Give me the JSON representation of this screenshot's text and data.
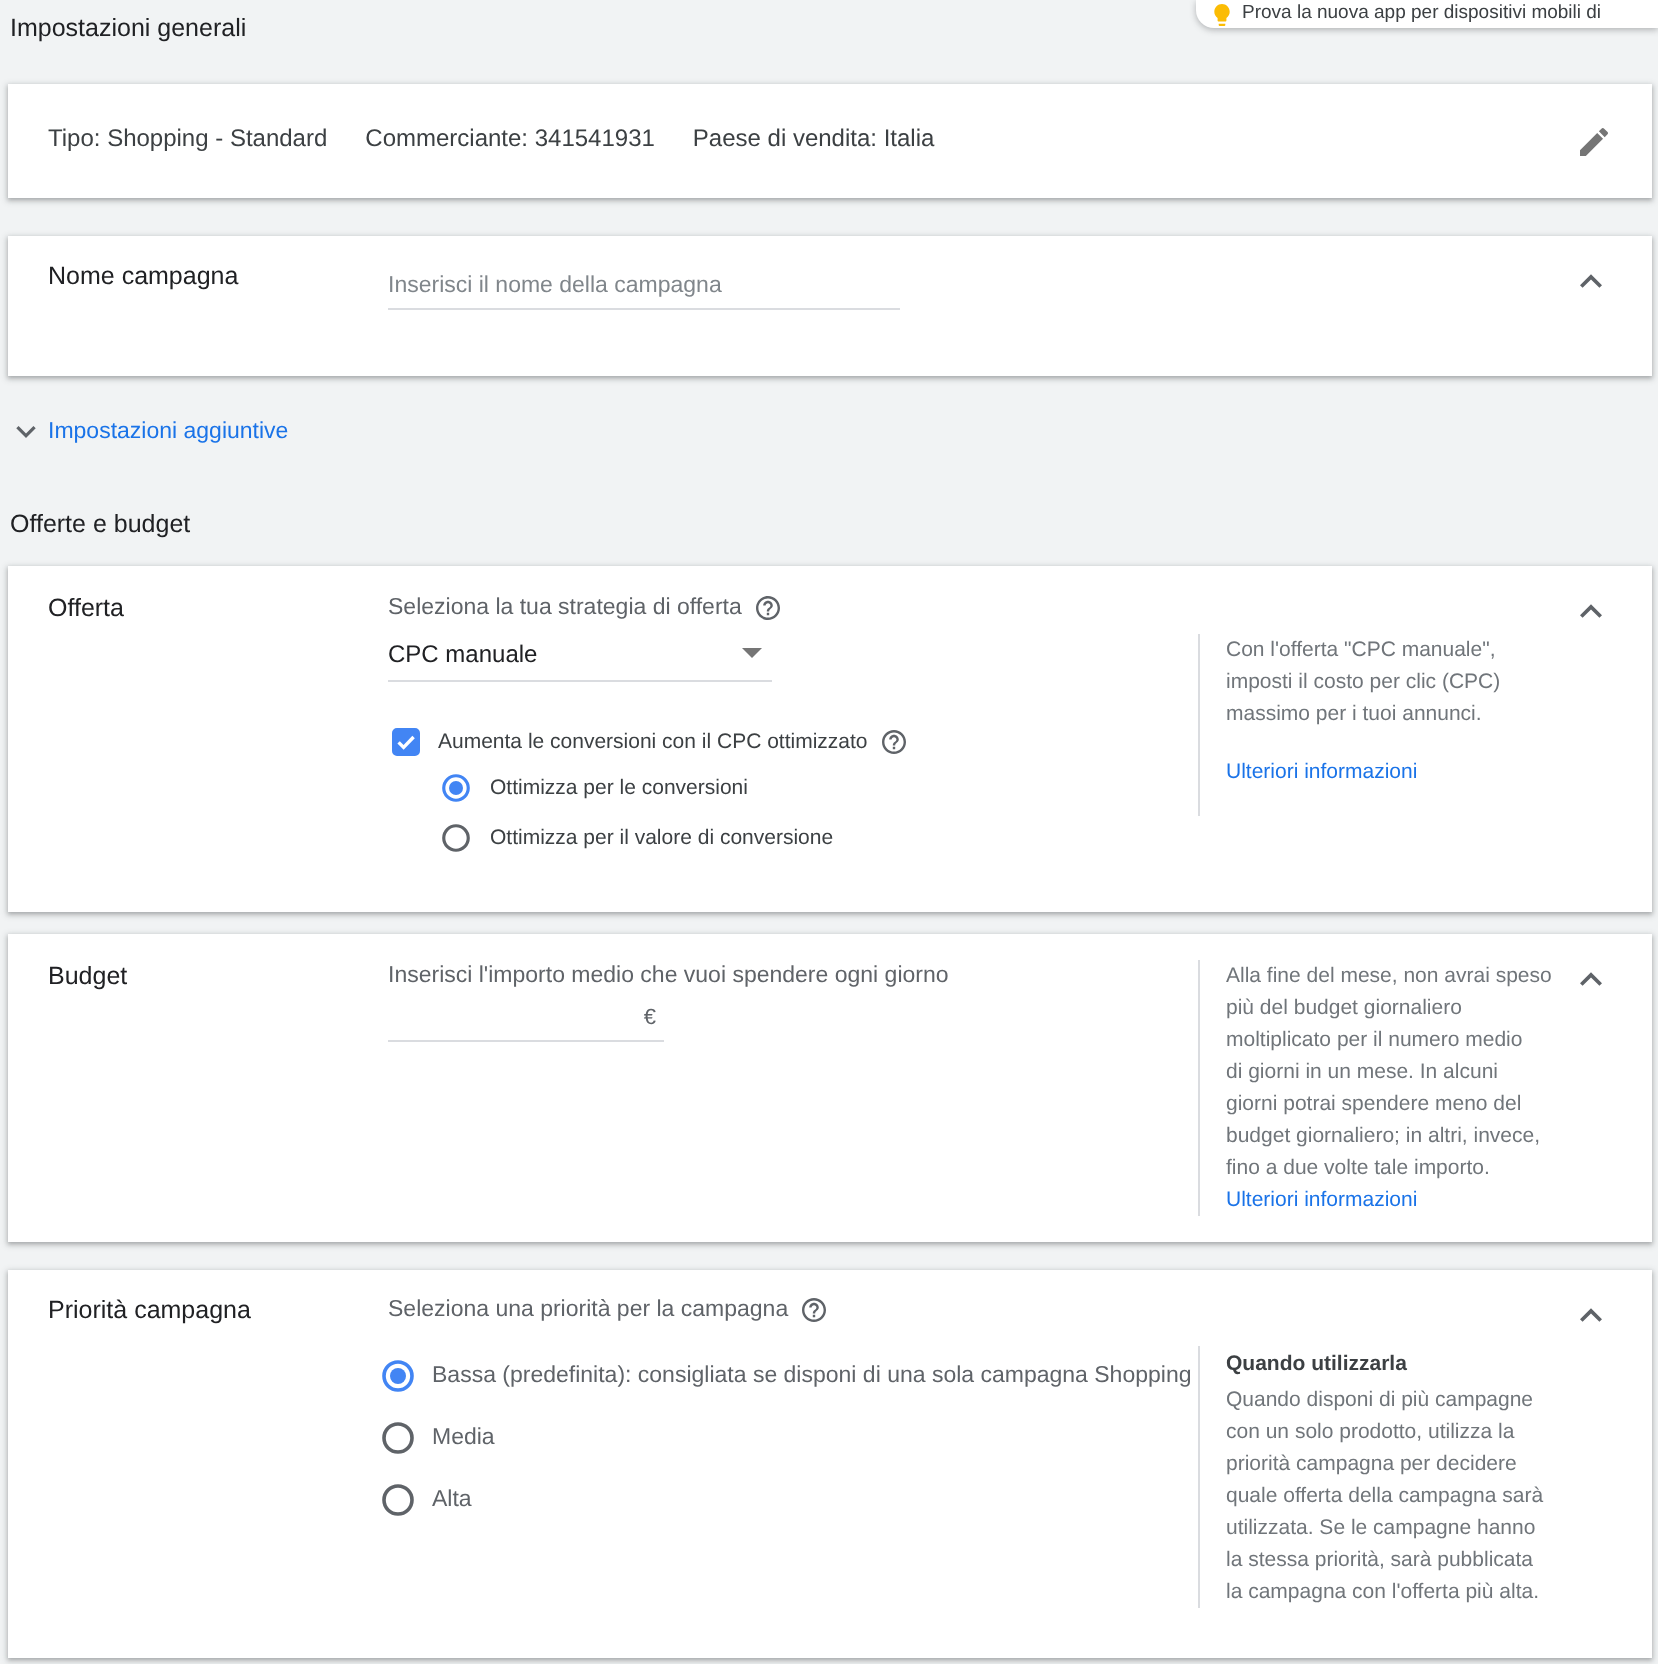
{
  "toast": {
    "text": "Prova la nuova app per dispositivi mobili di"
  },
  "general_settings": {
    "title": "Impostazioni generali",
    "summary": [
      "Tipo: Shopping - Standard",
      "Commerciante: 341541931",
      "Paese di vendita: Italia"
    ]
  },
  "campaign_name": {
    "label": "Nome campagna",
    "placeholder": "Inserisci il nome della campagna",
    "expanded": true
  },
  "additional_settings": {
    "label": "Impostazioni aggiuntive",
    "expanded": false
  },
  "bids_and_budget": {
    "title": "Offerte e budget",
    "sections": [
      {
        "kind": "bid",
        "label": "Offerta",
        "expanded": true,
        "prompt": "Seleziona la tua strategia di offerta",
        "prompt_help": true,
        "dropdown": "CPC manuale",
        "checkbox": {
          "label": "Aumenta le conversioni con il CPC ottimizzato",
          "checked": true,
          "help": true
        },
        "options": [
          {
            "label": "Ottimizza per le conversioni",
            "selected": true
          },
          {
            "label": "Ottimizza per il valore di conversione",
            "selected": false
          }
        ],
        "info": {
          "text": "Con l'offerta \"CPC manuale\",\nimposti il costo per clic (CPC)\nmassimo per i tuoi annunci.",
          "link": "Ulteriori informazioni"
        }
      },
      {
        "kind": "budget",
        "label": "Budget",
        "expanded": true,
        "prompt": "Inserisci l'importo medio che vuoi spendere ogni giorno",
        "amount_suffix": "€",
        "info": {
          "text": "Alla fine del mese, non avrai speso\npiù del budget giornaliero\nmoltiplicato per il numero medio\ndi giorni in un mese. In alcuni\ngiorni potrai spendere meno del\nbudget giornaliero; in altri, invece,\nfino a due volte tale importo.",
          "link": "Ulteriori informazioni"
        }
      },
      {
        "kind": "priority",
        "label": "Priorità campagna",
        "expanded": true,
        "prompt": "Seleziona una priorità per la campagna",
        "prompt_help": true,
        "options": [
          {
            "label": "Bassa (predefinita): consigliata se disponi di una sola campagna Shopping",
            "selected": true
          },
          {
            "label": "Media",
            "selected": false
          },
          {
            "label": "Alta",
            "selected": false
          }
        ],
        "info": {
          "title": "Quando utilizzarla",
          "text": "Quando disponi di più campagne\ncon un solo prodotto, utilizza la\npriorità campagna per decidere\nquale offerta della campagna sarà\nutilizzata. Se le campagne hanno\nla stessa priorità, sarà pubblicata\nla campagna con l'offerta più alta."
        }
      }
    ]
  }
}
